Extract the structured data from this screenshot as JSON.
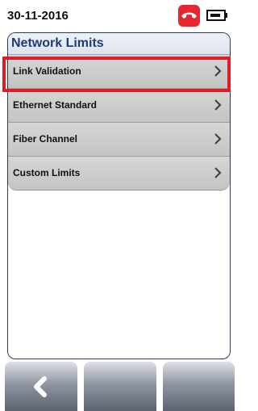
{
  "status": {
    "date": "30-11-2016",
    "phone_icon": "phone-hangup-icon",
    "battery_icon": "battery-charging-icon"
  },
  "panel": {
    "title": "Network Limits",
    "items": [
      {
        "label": "Link Validation",
        "selected": true
      },
      {
        "label": "Ethernet Standard"
      },
      {
        "label": "Fiber Channel"
      },
      {
        "label": "Custom Limits"
      }
    ]
  },
  "colors": {
    "accent": "#e31b23",
    "title": "#1f3c78",
    "menu_bg": "#cccccc"
  },
  "softkeys": {
    "left_icon": "back-arrow-icon"
  }
}
